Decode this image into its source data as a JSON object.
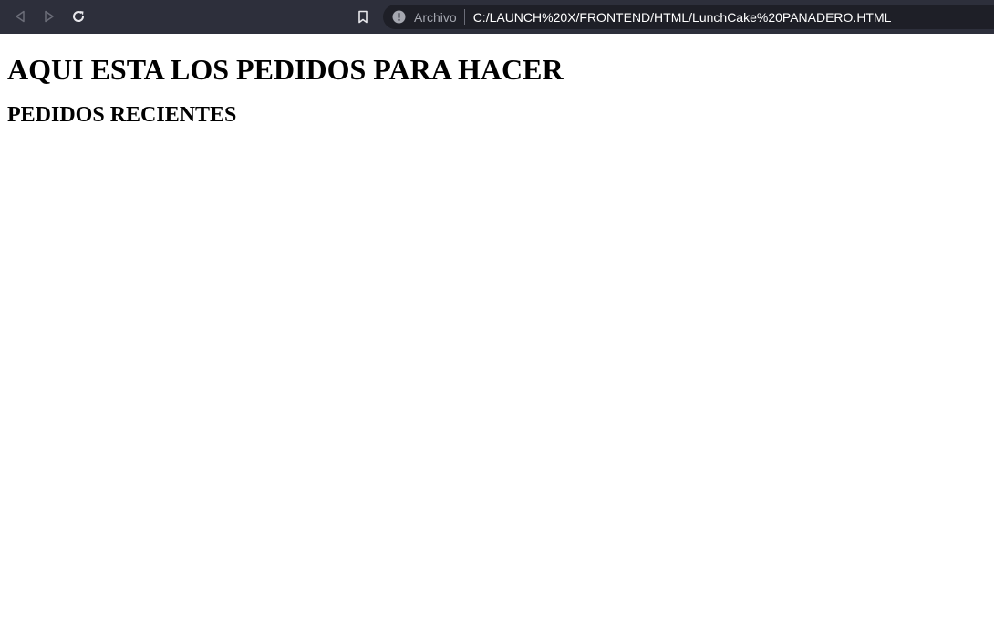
{
  "browser": {
    "back_icon": "back-arrow-icon",
    "forward_icon": "forward-arrow-icon",
    "reload_icon": "reload-icon",
    "bookmark_icon": "bookmark-icon",
    "info_icon": "info-icon",
    "scheme_label": "Archivo",
    "url": "C:/LAUNCH%20X/FRONTEND/HTML/LunchCake%20PANADERO.HTML",
    "colors": {
      "toolbar_bg": "#2d2f3b",
      "address_bg": "#1e1f27"
    }
  },
  "page": {
    "heading": "AQUI ESTA LOS PEDIDOS PARA HACER",
    "subheading": "PEDIDOS RECIENTES"
  }
}
